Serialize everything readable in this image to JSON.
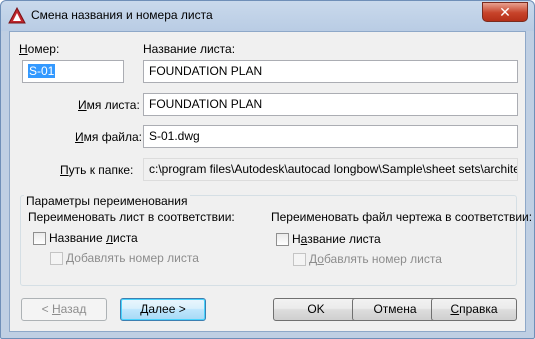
{
  "window": {
    "title": "Смена названия и номера листа",
    "close_glyph": "✕"
  },
  "number": {
    "label": "Номер:",
    "label_u": "Н",
    "label_rest": "омер:",
    "value": "S-01"
  },
  "sheet_title": {
    "label": "Название листа:",
    "value": "FOUNDATION PLAN"
  },
  "sheet_name": {
    "label_u": "И",
    "label_rest": "мя листа:",
    "value": "FOUNDATION PLAN"
  },
  "file_name": {
    "label_u": "И",
    "label_rest": "мя файла:",
    "value": "S-01.dwg"
  },
  "folder_path": {
    "label_u": "П",
    "label_rest": "уть к папке:",
    "value": "c:\\program files\\Autodesk\\autocad longbow\\Sample\\sheet sets\\architectural"
  },
  "rename_options": {
    "title": "Параметры переименования",
    "left_heading": "Переименовать лист в соответствии:",
    "right_heading": "Переименовать файл чертежа в соответствии:",
    "left_cb1": {
      "pre": "Название ",
      "u": "л",
      "post": "иста"
    },
    "left_cb2": {
      "pre": "",
      "u": "Д",
      "post": "обавлять номер листа"
    },
    "right_cb1": {
      "pre": "Н",
      "u": "а",
      "post": "звание листа"
    },
    "right_cb2": {
      "pre": "Д",
      "u": "о",
      "post": "бавлять номер листа"
    }
  },
  "buttons": {
    "back": {
      "pre": "< ",
      "u": "Н",
      "post": "азад"
    },
    "next": {
      "pre": "",
      "u": "Д",
      "post": "алее >"
    },
    "ok": "OK",
    "cancel": "Отмена",
    "help": {
      "pre": "",
      "u": "С",
      "post": "правка"
    }
  },
  "colors": {
    "selection": "#3399ff",
    "title_bar": "#bfcfe3",
    "close_button": "#c7432a"
  }
}
